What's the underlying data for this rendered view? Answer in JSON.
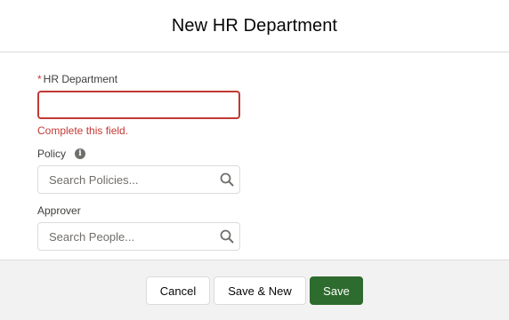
{
  "modal": {
    "title": "New HR Department"
  },
  "form": {
    "hr_department": {
      "required_marker": "*",
      "label": "HR Department",
      "value": "",
      "error": "Complete this field."
    },
    "policy": {
      "label": "Policy",
      "info_icon": "info-icon",
      "placeholder": "Search Policies...",
      "icon": "search-icon"
    },
    "approver": {
      "label": "Approver",
      "placeholder": "Search People...",
      "icon": "search-icon"
    }
  },
  "footer": {
    "cancel_label": "Cancel",
    "save_new_label": "Save & New",
    "save_label": "Save"
  },
  "colors": {
    "error": "#c23934",
    "brand": "#2e6b2e",
    "footer_bg": "#f3f2f2"
  }
}
